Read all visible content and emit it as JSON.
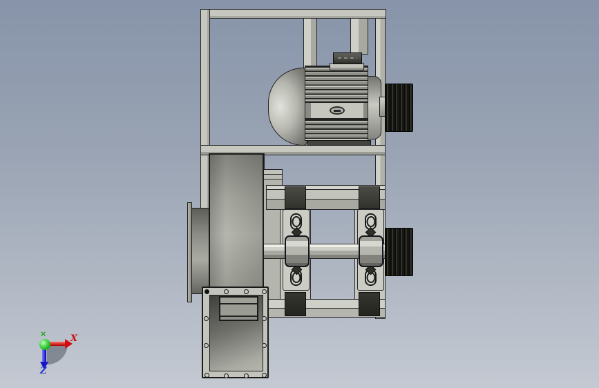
{
  "viewport": {
    "background_top_color": "#8794a9",
    "background_bottom_color": "#c4c9d2"
  },
  "triad": {
    "x_label": "X",
    "z_label": "Z",
    "y_glyph": "⨯",
    "x_color": "#cc1111",
    "y_color": "#18a818",
    "z_color": "#2233cc"
  },
  "scene": {
    "parts": [
      {
        "name": "support-frame",
        "color": "#c6c7bf"
      },
      {
        "name": "electric-motor",
        "color": "#b5b6ae"
      },
      {
        "name": "motor-terminal-box",
        "color": "#31322c"
      },
      {
        "name": "motor-pulley",
        "color": "#15160f"
      },
      {
        "name": "shaft-pulley",
        "color": "#15160f"
      },
      {
        "name": "drive-shaft",
        "color": "#b0b1a9"
      },
      {
        "name": "pillow-block-bearing",
        "count": 2,
        "color": "#a8a9a1"
      },
      {
        "name": "bearing-pedestal",
        "color": "#c2c3bb"
      },
      {
        "name": "spacer-block",
        "count": 4,
        "color": "#35362f"
      },
      {
        "name": "fan-housing",
        "color": "#a5a69e"
      },
      {
        "name": "inlet-cone",
        "color": "#8a8b84"
      },
      {
        "name": "outlet-duct",
        "color": "#8f908a"
      },
      {
        "name": "flange-bolt-hole",
        "count": 12
      }
    ]
  }
}
